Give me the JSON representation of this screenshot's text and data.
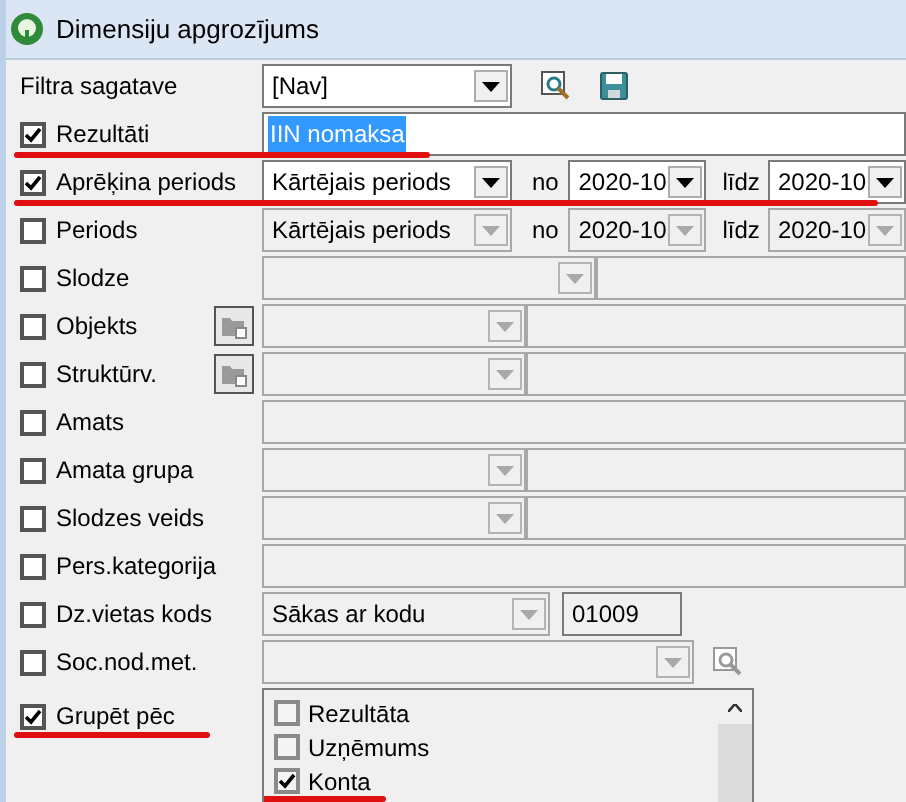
{
  "window": {
    "title": "Dimensiju apgrozījums"
  },
  "rows": [
    {
      "kind": "template",
      "label": "Filtra sagatave",
      "value": "[Nav]"
    },
    {
      "kind": "text",
      "label": "Rezultāti",
      "checked": true,
      "annotated": true,
      "value": "IIN nomaksa"
    },
    {
      "kind": "period",
      "label": "Aprēķina periods",
      "checked": true,
      "annotated": true,
      "disabled": false,
      "value": "Kārtējais periods",
      "from_label": "no",
      "from": "2020-10",
      "to_label": "līdz",
      "to": "2020-10"
    },
    {
      "kind": "period",
      "label": "Periods",
      "checked": false,
      "disabled": true,
      "value": "Kārtējais periods",
      "from_label": "no",
      "from": "2020-10",
      "to_label": "līdz",
      "to": "2020-10"
    },
    {
      "kind": "combo_short",
      "label": "Slodze",
      "checked": false
    },
    {
      "kind": "folder_combo",
      "label": "Objekts",
      "checked": false
    },
    {
      "kind": "folder_combo",
      "label": "Struktūrv.",
      "checked": false
    },
    {
      "kind": "field",
      "label": "Amats",
      "checked": false
    },
    {
      "kind": "combo_split",
      "label": "Amata grupa",
      "checked": false
    },
    {
      "kind": "combo_split",
      "label": "Slodzes veids",
      "checked": false
    },
    {
      "kind": "field",
      "label": "Pers.kategorija",
      "checked": false
    },
    {
      "kind": "code",
      "label": "Dz.vietas kods",
      "checked": false,
      "value": "Sākas ar kodu",
      "code": "01009"
    },
    {
      "kind": "combo_search",
      "label": "Soc.nod.met.",
      "checked": false
    },
    {
      "kind": "group",
      "label": "Grupēt pēc",
      "checked": true,
      "annotated": true,
      "items": [
        {
          "label": "Rezultāta",
          "checked": false
        },
        {
          "label": "Uzņēmums",
          "checked": false
        },
        {
          "label": "Konta",
          "checked": true,
          "annotated": true
        }
      ]
    }
  ]
}
